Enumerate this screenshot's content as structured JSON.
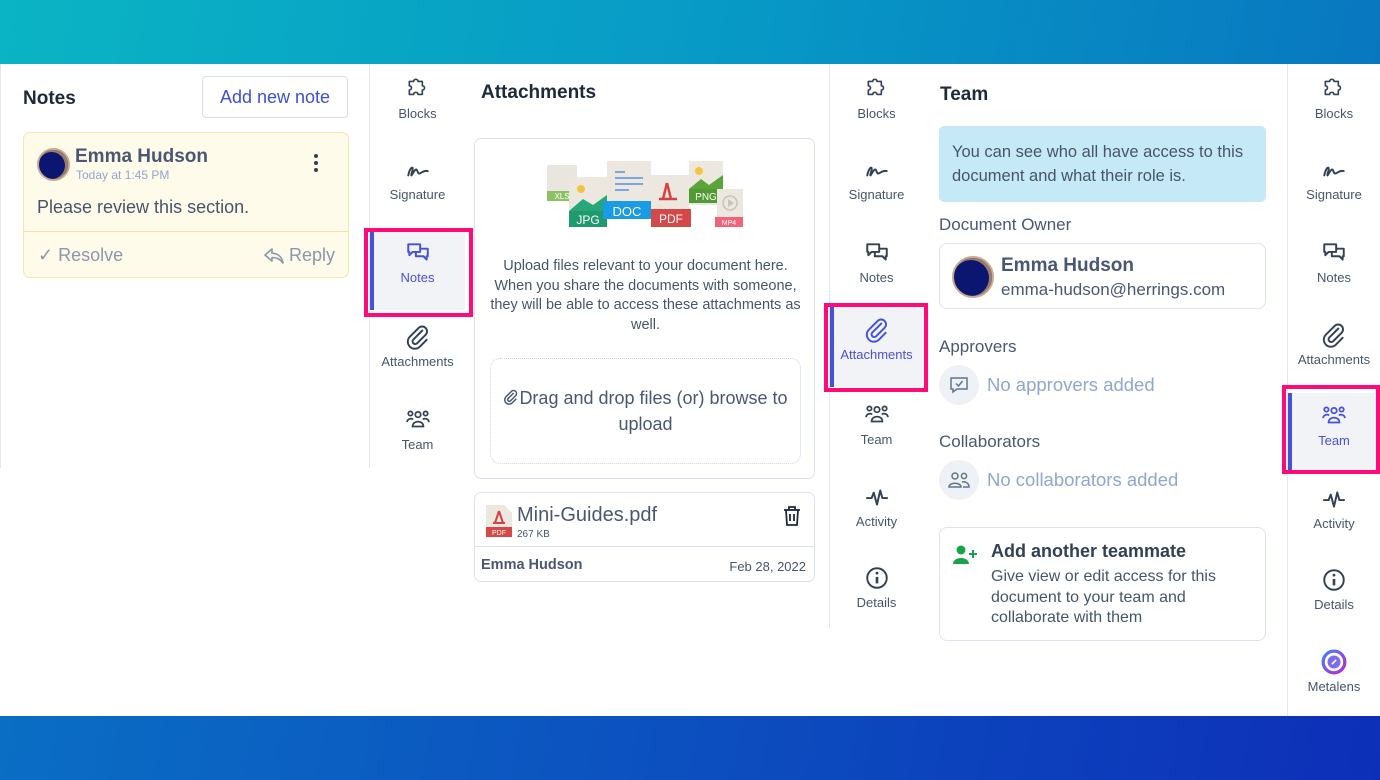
{
  "notes_panel": {
    "title": "Notes",
    "add_button": "Add new note",
    "note": {
      "author": "Emma Hudson",
      "time": "Today at 1:45 PM",
      "text": "Please review this section.",
      "resolve_label": "✓ Resolve",
      "reply_label": "Reply"
    }
  },
  "sidebar_items": {
    "blocks": "Blocks",
    "signature": "Signature",
    "notes": "Notes",
    "attachments": "Attachments",
    "team": "Team",
    "activity": "Activity",
    "details": "Details",
    "metalens": "Metalens"
  },
  "sidebars": [
    {
      "active": "notes",
      "items": [
        "blocks",
        "signature",
        "notes",
        "attachments",
        "team"
      ]
    },
    {
      "active": "attachments",
      "items": [
        "blocks",
        "signature",
        "notes",
        "attachments",
        "team",
        "activity",
        "details"
      ]
    },
    {
      "active": "team",
      "items": [
        "blocks",
        "signature",
        "notes",
        "attachments",
        "team",
        "activity",
        "details",
        "metalens"
      ]
    }
  ],
  "attachments_panel": {
    "title": "Attachments",
    "illustration_labels": [
      "XLS",
      "JPG",
      "DOC",
      "PDF",
      "PNG",
      "MP4"
    ],
    "description": "Upload files relevant to your document here. When you share the documents with someone, they will be able to access these attachments as well.",
    "dropzone_label": "Drag and drop files (or) browse to upload",
    "file": {
      "name": "Mini-Guides.pdf",
      "type_badge": "PDF",
      "size": "267 KB",
      "uploaded_by": "Emma Hudson",
      "date": "Feb 28, 2022"
    }
  },
  "team_panel": {
    "title": "Team",
    "info": "You can see who all have access to this document and what their role is.",
    "owner_label": "Document Owner",
    "owner": {
      "name": "Emma Hudson",
      "email": "emma-hudson@herrings.com"
    },
    "approvers_label": "Approvers",
    "approvers_empty": "No approvers added",
    "collaborators_label": "Collaborators",
    "collaborators_empty": "No collaborators added",
    "add_teammate": {
      "title": "Add another teammate",
      "description": "Give view or edit access for this document to your team and collaborate with them"
    }
  },
  "colors": {
    "accent": "#4451d8",
    "highlight": "#ff0a78",
    "note_bg": "#fffbea",
    "info_bg": "#c6e9f7",
    "add_teammate_icon": "#16a34a"
  }
}
